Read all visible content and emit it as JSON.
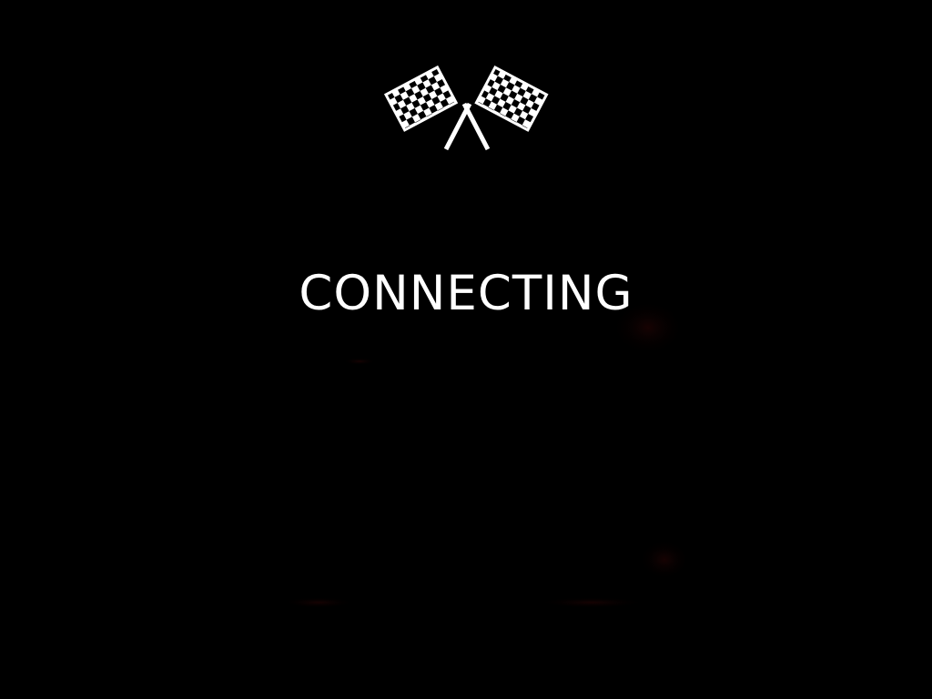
{
  "screen": {
    "status_text": "CONNECTING",
    "logo_icon": "checkered-flags-icon",
    "background_color": "#000000",
    "text_color": "#ffffff"
  }
}
